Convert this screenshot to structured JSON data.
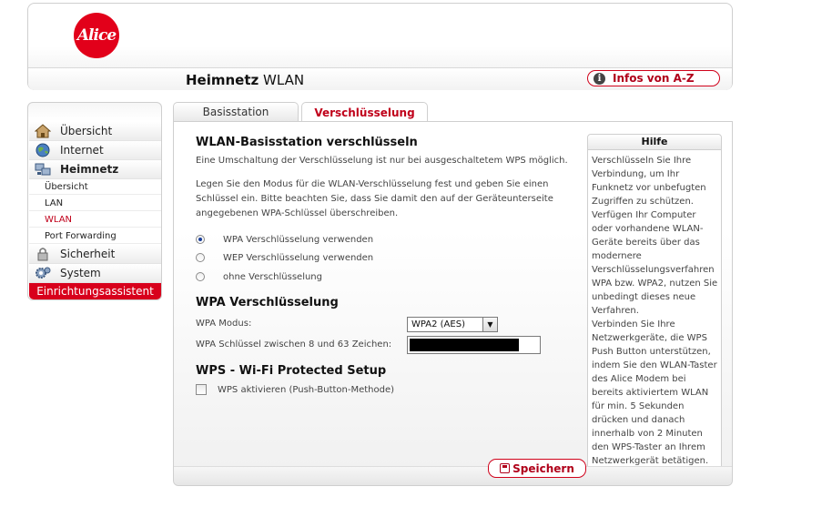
{
  "header": {
    "logo_text": "Alice",
    "title_bold": "Heimnetz",
    "title_rest": " WLAN",
    "infos_label": "Infos von A-Z",
    "info_icon_glyph": "i"
  },
  "sidebar": {
    "items": [
      {
        "label": "Übersicht",
        "icon": "house-icon"
      },
      {
        "label": "Internet",
        "icon": "globe-icon"
      },
      {
        "label": "Heimnetz",
        "icon": "network-icon"
      }
    ],
    "subitems": [
      {
        "label": "Übersicht"
      },
      {
        "label": "LAN"
      },
      {
        "label": "WLAN"
      },
      {
        "label": "Port Forwarding"
      }
    ],
    "items2": [
      {
        "label": "Sicherheit",
        "icon": "lock-icon"
      },
      {
        "label": "System",
        "icon": "gear-icon"
      }
    ],
    "wizard_label": "Einrichtungsassistent"
  },
  "tabs": [
    {
      "label": "Basisstation"
    },
    {
      "label": "Verschlüsselung"
    }
  ],
  "main": {
    "section1_title": "WLAN-Basisstation verschlüsseln",
    "section1_note": "Eine Umschaltung der Verschlüsselung ist nur bei ausgeschaltetem WPS möglich.",
    "section1_desc": "Legen Sie den Modus für die WLAN-Verschlüsselung fest und geben Sie einen Schlüssel ein. Bitte beachten Sie, dass Sie damit den auf der Geräteunterseite angegebenen WPA-Schlüssel überschreiben.",
    "radios": [
      {
        "label": "WPA Verschlüsselung verwenden",
        "checked": true
      },
      {
        "label": "WEP Verschlüsselung verwenden",
        "checked": false
      },
      {
        "label": "ohne Verschlüsselung",
        "checked": false
      }
    ],
    "section2_title": "WPA Verschlüsselung",
    "wpa_mode_label": "WPA Modus:",
    "wpa_mode_value": "WPA2 (AES)",
    "wpa_key_label": "WPA Schlüssel zwischen 8 und 63 Zeichen:",
    "section3_title": "WPS - Wi-Fi Protected Setup",
    "wps_checkbox_label": "WPS aktivieren (Push-Button-Methode)",
    "save_label": "Speichern"
  },
  "help": {
    "title": "Hilfe",
    "text": "Verschlüsseln Sie Ihre Verbindung, um Ihr Funknetz vor unbefugten Zugriffen zu schützen. Verfügen Ihr Computer oder vorhandene WLAN-Geräte bereits über das modernere Verschlüsselungsverfahren WPA bzw. WPA2, nutzen Sie unbedingt dieses neue Verfahren.",
    "text2": "Verbinden Sie Ihre Netzwerkgeräte, die WPS Push Button unterstützen, indem Sie den WLAN-Taster des Alice Modem bei bereits aktiviertem WLAN für min. 5 Sekunden drücken und danach innerhalb von 2 Minuten den WPS-Taster an Ihrem Netzwerkgerät betätigen."
  },
  "colors": {
    "brand_red": "#e2001a",
    "accent_red": "#c0001a"
  }
}
